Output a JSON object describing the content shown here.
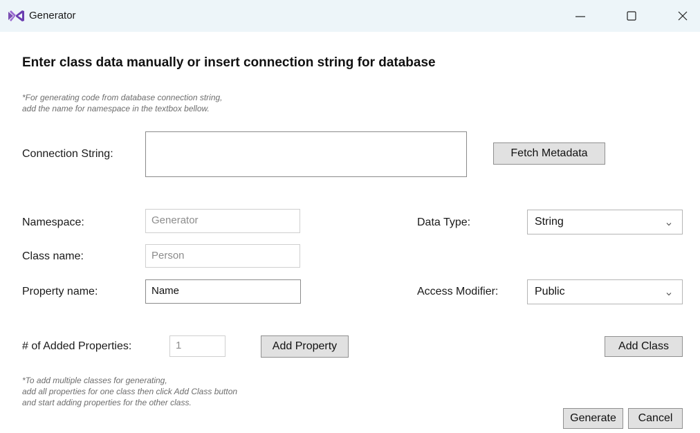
{
  "window": {
    "title": "Generator",
    "icon": "visual-studio-icon",
    "controls": [
      "minimize-icon",
      "maximize-icon",
      "close-icon"
    ]
  },
  "heading": "Enter class data manually or insert connection string for database",
  "note_top": {
    "line1": "*For generating code from database connection string,",
    "line2": "add the name for namespace in the textbox bellow."
  },
  "connection": {
    "label": "Connection String:",
    "value": "",
    "fetch_button": "Fetch Metadata"
  },
  "namespace": {
    "label": "Namespace:",
    "placeholder": "Generator"
  },
  "class_name": {
    "label": "Class name:",
    "placeholder": "Person"
  },
  "property_name": {
    "label": "Property name:",
    "value": "Name"
  },
  "data_type": {
    "label": "Data Type:",
    "selected": "String"
  },
  "access_modifier": {
    "label": "Access Modifier:",
    "selected": "Public"
  },
  "added_properties": {
    "label": "# of Added Properties:",
    "value": "1"
  },
  "buttons": {
    "add_property": "Add Property",
    "add_class": "Add Class",
    "generate": "Generate",
    "cancel": "Cancel"
  },
  "note_bottom": {
    "line1": "*To add multiple classes for generating,",
    "line2": "add all properties for one class then click Add Class button",
    "line3": "and start adding properties for the other class."
  }
}
